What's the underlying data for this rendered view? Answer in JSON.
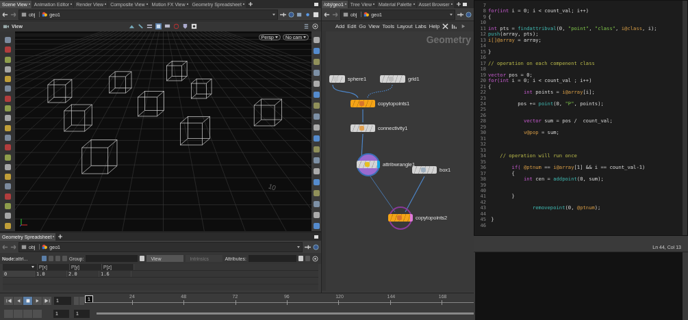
{
  "scene_panel": {
    "tabs": [
      {
        "label": "Scene View",
        "selected": true
      },
      {
        "label": "Animation Editor",
        "selected": false
      },
      {
        "label": "Render View",
        "selected": false
      },
      {
        "label": "Composite View",
        "selected": false
      },
      {
        "label": "Motion FX View",
        "selected": false
      },
      {
        "label": "Geometry Spreadsheet",
        "selected": false
      }
    ],
    "path": [
      "obj",
      "geo1"
    ],
    "viewport_label": "View",
    "camera_buttons": [
      "Persp",
      "No cam"
    ],
    "grid_label": "10"
  },
  "network_panel": {
    "tabs": [
      {
        "label": "/obj/geo1",
        "selected": true
      },
      {
        "label": "Tree View",
        "selected": false
      },
      {
        "label": "Material Palette",
        "selected": false
      },
      {
        "label": "Asset Browser",
        "selected": false
      }
    ],
    "path": [
      "obj",
      "geo1"
    ],
    "menu": [
      "Add",
      "Edit",
      "Go",
      "View",
      "Tools",
      "Layout",
      "Labs",
      "Help"
    ],
    "context_label": "Geometry",
    "nodes": [
      {
        "name": "sphere1",
        "kind": "plain",
        "selected": false,
        "display": false
      },
      {
        "name": "grid1",
        "kind": "plain",
        "selected": false,
        "display": false
      },
      {
        "name": "copytopoints1",
        "kind": "copy",
        "selected": false,
        "display": false
      },
      {
        "name": "connectivity1",
        "kind": "plain",
        "selected": false,
        "display": false
      },
      {
        "name": "attribwrangle1",
        "kind": "plain",
        "selected": true,
        "display": false
      },
      {
        "name": "box1",
        "kind": "plain",
        "selected": false,
        "display": false
      },
      {
        "name": "copytopoints2",
        "kind": "copy",
        "selected": false,
        "display": true
      }
    ]
  },
  "code_editor": {
    "lines": [
      {
        "number": "7"
      },
      {
        "number": "8",
        "tokens": [
          {
            "kind": "kw",
            "text": "for(int"
          },
          {
            "kind": "plain",
            "text": " i = 0; i < count_val; i++)"
          }
        ]
      },
      {
        "number": "9",
        "tokens": [
          {
            "kind": "plain",
            "text": "{"
          }
        ]
      },
      {
        "number": "10"
      },
      {
        "number": "11",
        "tokens": [
          {
            "kind": "kw",
            "text": "int"
          },
          {
            "kind": "plain",
            "text": " pts = "
          },
          {
            "kind": "fn",
            "text": "findattribval"
          },
          {
            "kind": "plain",
            "text": "(0, "
          },
          {
            "kind": "str",
            "text": "\"point\""
          },
          {
            "kind": "plain",
            "text": ", "
          },
          {
            "kind": "str",
            "text": "\"class\""
          },
          {
            "kind": "plain",
            "text": ", "
          },
          {
            "kind": "attr",
            "text": "i@class"
          },
          {
            "kind": "plain",
            "text": ", i);"
          }
        ]
      },
      {
        "number": "12",
        "tokens": [
          {
            "kind": "fn",
            "text": "push"
          },
          {
            "kind": "plain",
            "text": "(array, pts);"
          }
        ]
      },
      {
        "number": "13",
        "tokens": [
          {
            "kind": "attr",
            "text": "i[]@array"
          },
          {
            "kind": "plain",
            "text": " = array;"
          }
        ]
      },
      {
        "number": "14"
      },
      {
        "number": "15",
        "tokens": [
          {
            "kind": "plain",
            "text": "}"
          }
        ]
      },
      {
        "number": "16"
      },
      {
        "number": "17",
        "tokens": [
          {
            "kind": "cm",
            "text": "// operation on each compenent class"
          }
        ]
      },
      {
        "number": "18"
      },
      {
        "number": "19",
        "tokens": [
          {
            "kind": "kw",
            "text": "vector"
          },
          {
            "kind": "plain",
            "text": " pos = 0;"
          }
        ]
      },
      {
        "number": "20",
        "tokens": [
          {
            "kind": "kw",
            "text": "for(int"
          },
          {
            "kind": "plain",
            "text": " i = 0; i < count_val ; i++)"
          }
        ]
      },
      {
        "number": "21",
        "tokens": [
          {
            "kind": "plain",
            "text": "{"
          }
        ]
      },
      {
        "number": "22",
        "tokens": [
          {
            "kind": "kw",
            "text": "            int"
          },
          {
            "kind": "plain",
            "text": " points = "
          },
          {
            "kind": "attr",
            "text": "i@array"
          },
          {
            "kind": "plain",
            "text": "[i];"
          }
        ]
      },
      {
        "number": "23"
      },
      {
        "number": "24",
        "tokens": [
          {
            "kind": "plain",
            "text": "          pos += "
          },
          {
            "kind": "fn",
            "text": "point"
          },
          {
            "kind": "plain",
            "text": "(0, "
          },
          {
            "kind": "str",
            "text": "\"P\""
          },
          {
            "kind": "plain",
            "text": ", points);"
          }
        ]
      },
      {
        "number": "25"
      },
      {
        "number": "26"
      },
      {
        "number": "28",
        "tokens": [
          {
            "kind": "kw",
            "text": "            vector"
          },
          {
            "kind": "plain",
            "text": " sum = pos /  count_val;"
          }
        ]
      },
      {
        "number": "29"
      },
      {
        "number": "30",
        "tokens": [
          {
            "kind": "attr",
            "text": "            v@pop"
          },
          {
            "kind": "plain",
            "text": " = sum;"
          }
        ]
      },
      {
        "number": "31"
      },
      {
        "number": "32"
      },
      {
        "number": "33"
      },
      {
        "number": "34",
        "tokens": [
          {
            "kind": "cm",
            "text": "    // operation will run once"
          }
        ]
      },
      {
        "number": "35"
      },
      {
        "number": "36",
        "tokens": [
          {
            "kind": "kw",
            "text": "        if("
          },
          {
            "kind": "attr",
            "text": " @ptnum"
          },
          {
            "kind": "plain",
            "text": " == "
          },
          {
            "kind": "attr",
            "text": "i@array"
          },
          {
            "kind": "plain",
            "text": "[1] && i == count_val-1)"
          }
        ]
      },
      {
        "number": "37",
        "tokens": [
          {
            "kind": "plain",
            "text": "        {"
          }
        ]
      },
      {
        "number": "38",
        "tokens": [
          {
            "kind": "kw",
            "text": "            int"
          },
          {
            "kind": "plain",
            "text": " cen = "
          },
          {
            "kind": "fn",
            "text": "addpoint"
          },
          {
            "kind": "plain",
            "text": "(0, sum);"
          }
        ]
      },
      {
        "number": "39"
      },
      {
        "number": "40"
      },
      {
        "number": "41",
        "tokens": [
          {
            "kind": "plain",
            "text": "        }"
          }
        ]
      },
      {
        "number": "42"
      },
      {
        "number": "43",
        "tokens": [
          {
            "kind": "fn",
            "text": "               removepoint"
          },
          {
            "kind": "plain",
            "text": "(0, "
          },
          {
            "kind": "attr",
            "text": "@ptnum"
          },
          {
            "kind": "plain",
            "text": ");"
          }
        ]
      },
      {
        "number": "44"
      },
      {
        "number": "45",
        "tokens": [
          {
            "kind": "plain",
            "text": " }"
          }
        ]
      },
      {
        "number": "46"
      }
    ],
    "status": "Ln 44, Col 13"
  },
  "spreadsheet": {
    "tabs": [
      {
        "label": "Geometry Spreadsheet",
        "selected": true
      }
    ],
    "path": [
      "obj",
      "geo1"
    ],
    "node_label": "**Node:**attri...",
    "group_label": "Group:",
    "view_dropdown": "View",
    "intrinsics_dropdown": "Intrinsics",
    "attributes_label": "Attributes:",
    "columns": [
      "P[x]",
      "P[y]",
      "P[z]"
    ],
    "rows": [
      {
        "index": "0",
        "values": [
          "1.0",
          "2.0",
          "1.6"
        ]
      }
    ]
  },
  "timeline": {
    "frame": "1",
    "current_frame": "1",
    "ticks": [
      "24",
      "48",
      "72",
      "96",
      "120",
      "144",
      "168"
    ],
    "start": "1",
    "end": "1",
    "range": {
      "level": 1
    }
  }
}
